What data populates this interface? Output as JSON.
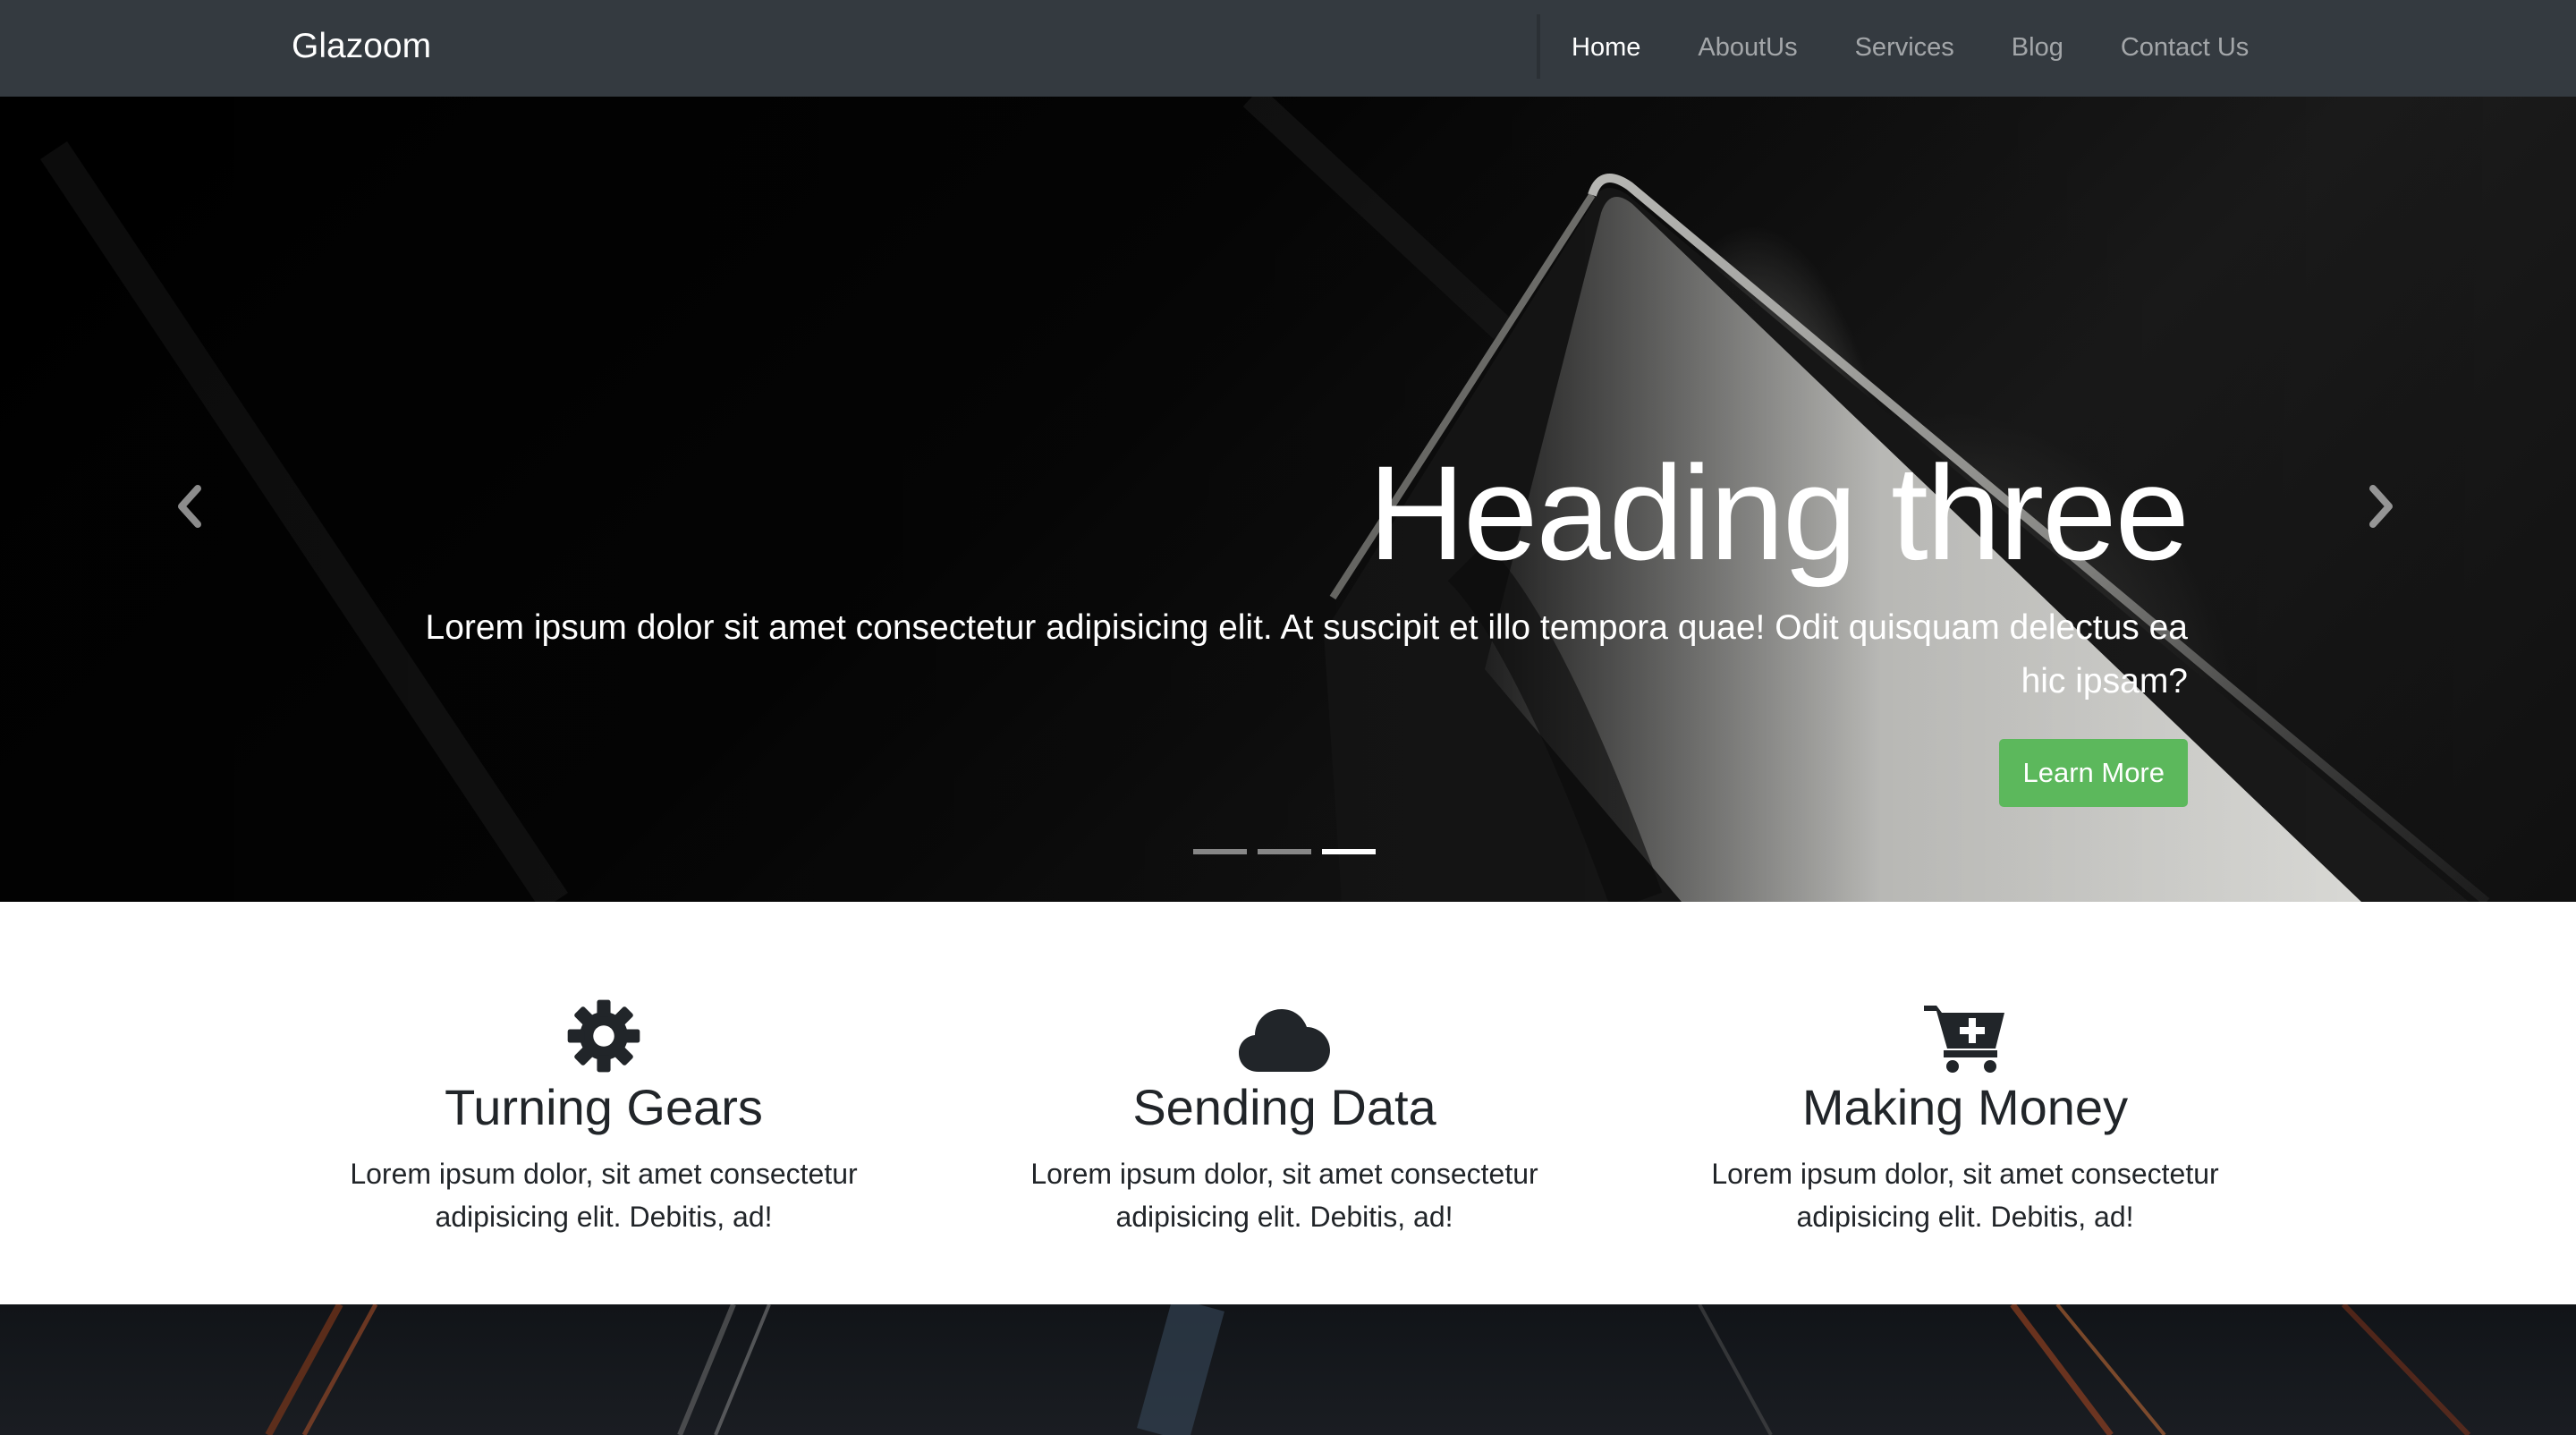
{
  "navbar": {
    "brand": "Glazoom",
    "links": [
      {
        "label": "Home",
        "active": true
      },
      {
        "label": "AboutUs",
        "active": false
      },
      {
        "label": "Services",
        "active": false
      },
      {
        "label": "Blog",
        "active": false
      },
      {
        "label": "Contact Us",
        "active": false
      }
    ]
  },
  "carousel": {
    "heading": "Heading three",
    "text": "Lorem ipsum dolor sit amet consectetur adipisicing elit. At suscipit et illo tempora quae! Odit quisquam delectus ea hic ipsam?",
    "button_label": "Learn More",
    "button_color": "#5cb85c",
    "slide_count": 3,
    "active_slide": 3,
    "prev_icon": "chevron-left-icon",
    "next_icon": "chevron-right-icon"
  },
  "features": [
    {
      "icon": "gear-icon",
      "title": "Turning Gears",
      "text": "Lorem ipsum dolor, sit amet consectetur adipisicing elit. Debitis, ad!"
    },
    {
      "icon": "cloud-icon",
      "title": "Sending Data",
      "text": "Lorem ipsum dolor, sit amet consectetur adipisicing elit. Debitis, ad!"
    },
    {
      "icon": "cart-plus-icon",
      "title": "Making Money",
      "text": "Lorem ipsum dolor, sit amet consectetur adipisicing elit. Debitis, ad!"
    }
  ],
  "colors": {
    "navbar_bg": "#343a40",
    "accent_green": "#5cb85c",
    "text_dark": "#212529"
  }
}
